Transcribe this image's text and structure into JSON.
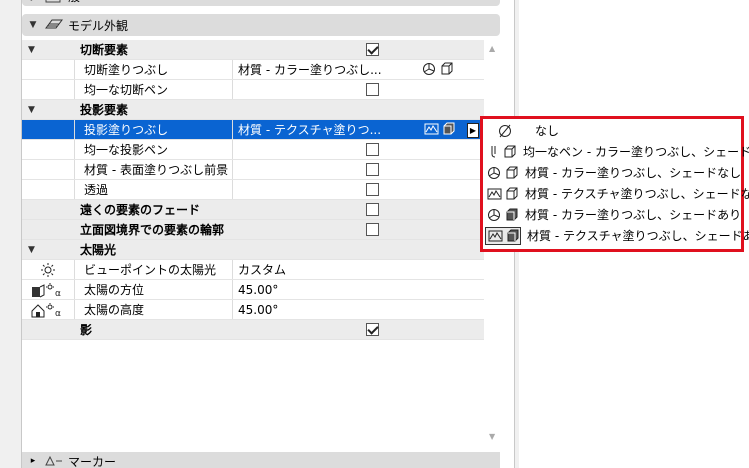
{
  "top_header": {
    "title": "般"
  },
  "section": {
    "title": "モデル外観"
  },
  "rows": [
    {
      "type": "group",
      "name": "切断要素",
      "check": true
    },
    {
      "type": "item",
      "name": "切断塗りつぶし",
      "value": "材質 - カラー塗りつぶし...",
      "icons": "pie-fill-box"
    },
    {
      "type": "item",
      "name": "均一な切断ペン",
      "check": false
    },
    {
      "type": "group",
      "name": "投影要素"
    },
    {
      "type": "item",
      "name": "投影塗りつぶし",
      "value": "材質 - テクスチャ塗りつ...",
      "selected": true
    },
    {
      "type": "item",
      "name": "均一な投影ペン",
      "check": false
    },
    {
      "type": "item",
      "name": "材質 - 表面塗りつぶし前景",
      "check": false
    },
    {
      "type": "item",
      "name": "透過",
      "check": false
    },
    {
      "type": "group-plain",
      "name": "遠くの要素のフェード",
      "check": false
    },
    {
      "type": "group-plain",
      "name": "立面図境界での要素の輪郭",
      "check": false
    },
    {
      "type": "group",
      "name": "太陽光"
    },
    {
      "type": "item",
      "name": "ビューポイントの太陽光",
      "value": "カスタム",
      "icon": "sun-icon"
    },
    {
      "type": "item",
      "name": "太陽の方位",
      "value": "45.00°",
      "icon": "sun-azimuth-icon"
    },
    {
      "type": "item",
      "name": "太陽の高度",
      "value": "45.00°",
      "icon": "sun-altitude-icon"
    },
    {
      "type": "group-plain",
      "name": "影",
      "check": true
    }
  ],
  "popup": {
    "items": [
      {
        "label": "なし",
        "icon": "none-icon"
      },
      {
        "label": "均一なペン - カラー塗りつぶし、シェードなし",
        "icon": "pen-box-icon"
      },
      {
        "label": "材質 - カラー塗りつぶし、シェードなし",
        "icon": "pie-box-icon"
      },
      {
        "label": "材質 - テクスチャ塗りつぶし、シェードなし",
        "icon": "texture-box-icon"
      },
      {
        "label": "材質 - カラー塗りつぶし、シェードあり",
        "icon": "pie-shaded-box-icon"
      },
      {
        "label": "材質 - テクスチャ塗りつぶし、シェードあり",
        "icon": "texture-shaded-box-icon",
        "selected": true
      }
    ]
  },
  "bottom_header": {
    "title": "マーカー"
  },
  "colors": {
    "selection": "#0a64d2",
    "highlight_border": "#e0101e",
    "header_bg": "#dcdcdc"
  }
}
